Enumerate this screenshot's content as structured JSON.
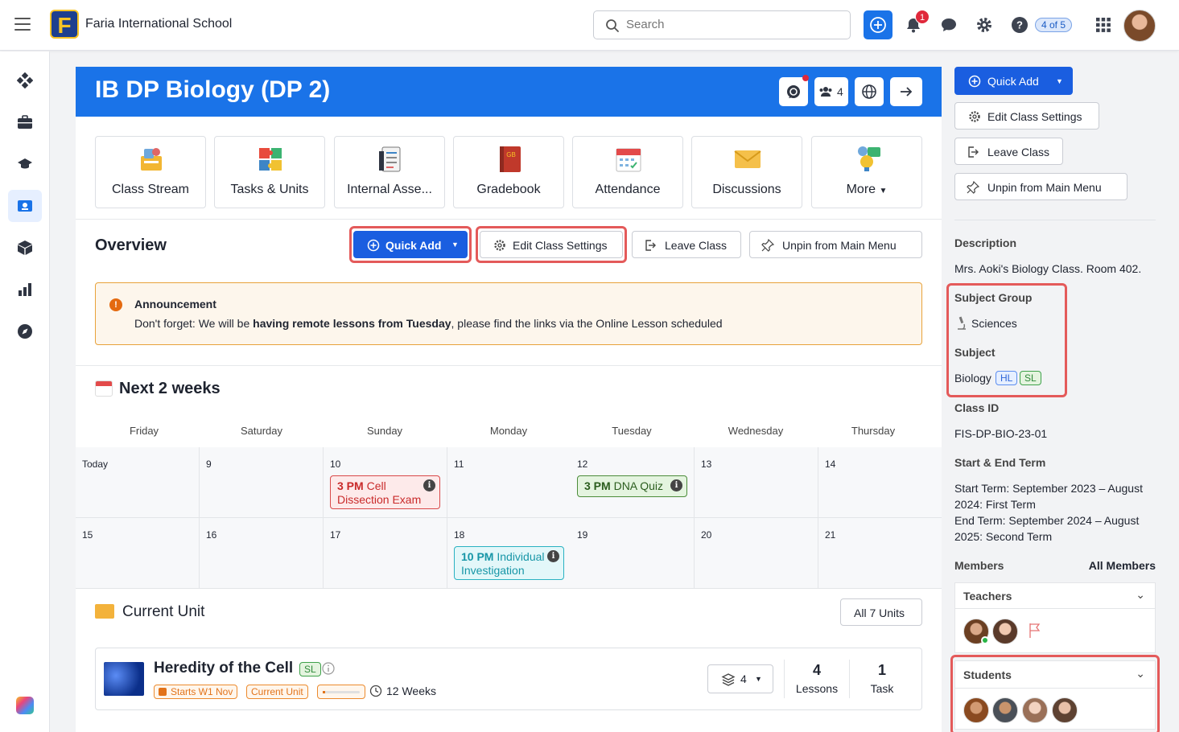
{
  "topbar": {
    "school_name": "Faria International School",
    "logo_letter": "F",
    "search_placeholder": "Search",
    "notification_count": "1",
    "page_indicator": "4 of 5"
  },
  "class": {
    "title": "IB DP Biology (DP 2)",
    "member_count": "4"
  },
  "tiles": [
    {
      "label": "Class Stream",
      "icon": "class-stream-icon"
    },
    {
      "label": "Tasks & Units",
      "icon": "puzzle-icon"
    },
    {
      "label": "Internal Asse...",
      "icon": "assessment-icon"
    },
    {
      "label": "Gradebook",
      "icon": "gradebook-icon"
    },
    {
      "label": "Attendance",
      "icon": "calendar-icon"
    },
    {
      "label": "Discussions",
      "icon": "envelope-icon"
    },
    {
      "label": "More",
      "icon": "more-icon"
    }
  ],
  "overview": {
    "title": "Overview",
    "quick_add": "Quick Add",
    "edit_settings": "Edit Class Settings",
    "leave_class": "Leave Class",
    "unpin": "Unpin from Main Menu"
  },
  "announcement": {
    "title": "Announcement",
    "text_before": "Don't forget: We will be ",
    "text_bold": "having remote lessons from Tuesday",
    "text_after": ", please find the links via the Online Lesson scheduled"
  },
  "calendar": {
    "title": "Next 2 weeks",
    "days": [
      "Friday",
      "Saturday",
      "Sunday",
      "Monday",
      "Tuesday",
      "Wednesday",
      "Thursday"
    ],
    "week1": [
      "Today",
      "9",
      "10",
      "11",
      "12",
      "13",
      "14"
    ],
    "week2": [
      "15",
      "16",
      "17",
      "18",
      "19",
      "20",
      "21"
    ],
    "events": [
      {
        "time": "3 PM",
        "title": "Cell Dissection Exam",
        "color": "#d94848"
      },
      {
        "time": "3 PM",
        "title": "DNA Quiz",
        "color": "#4c8c3a"
      },
      {
        "time": "10 PM",
        "title": "Individual Investigation",
        "color": "#2ab2c2"
      }
    ]
  },
  "current_unit": {
    "title": "Current Unit",
    "all_units": "All 7 Units",
    "unit_name": "Heredity of the Cell",
    "level": "SL",
    "starts": "Starts W1 Nov",
    "status": "Current Unit",
    "duration": "12 Weeks",
    "stack_count": "4",
    "lessons_count": "4",
    "lessons_label": "Lessons",
    "task_count": "1",
    "task_label": "Task"
  },
  "side": {
    "quick_add": "Quick Add",
    "edit_settings": "Edit Class Settings",
    "leave_class": "Leave Class",
    "unpin": "Unpin from Main Menu",
    "description_label": "Description",
    "description": "Mrs. Aoki's Biology Class. Room 402.",
    "subject_group_label": "Subject Group",
    "subject_group": "Sciences",
    "subject_label": "Subject",
    "subject": "Biology",
    "hl": "HL",
    "sl": "SL",
    "class_id_label": "Class ID",
    "class_id": "FIS-DP-BIO-23-01",
    "term_label": "Start & End Term",
    "start_term": "Start Term: September 2023 – August 2024: First Term",
    "end_term": "End Term: September 2024 – August 2025: Second Term",
    "members_label": "Members",
    "all_members": "All Members",
    "teachers_label": "Teachers",
    "students_label": "Students"
  },
  "colors": {
    "primary": "#1a73e8",
    "highlight": "#e45a5a",
    "announcement_border": "#e8a23a"
  }
}
